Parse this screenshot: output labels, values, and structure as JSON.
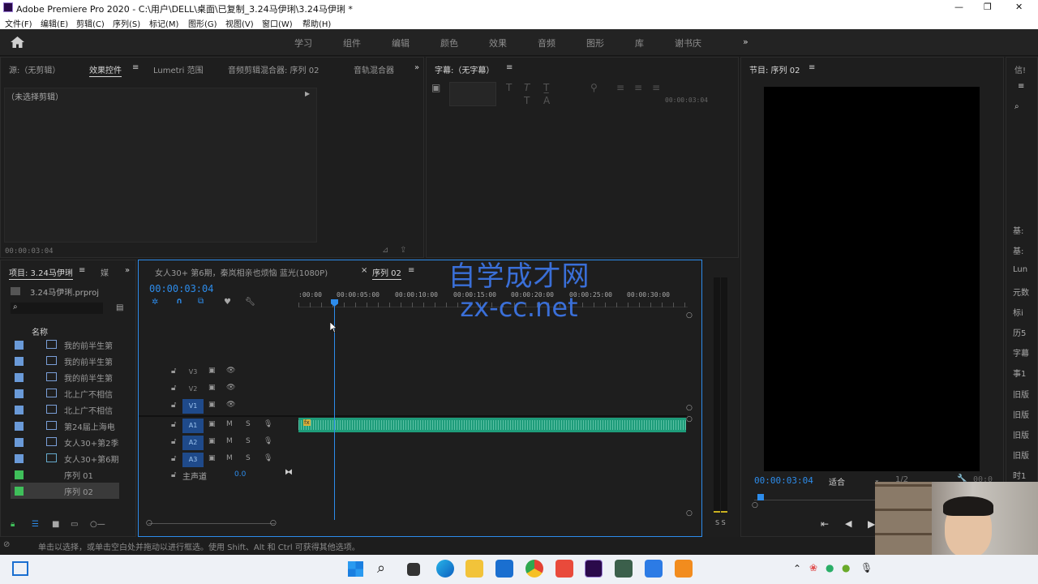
{
  "window": {
    "title": "Adobe Premiere Pro 2020 - C:\\用户\\DELL\\桌面\\已复制_3.24马伊琍\\3.24马伊琍 *",
    "controls": [
      "—",
      "❐",
      "✕"
    ]
  },
  "menu": [
    "文件(F)",
    "编辑(E)",
    "剪辑(C)",
    "序列(S)",
    "标记(M)",
    "图形(G)",
    "视图(V)",
    "窗口(W)",
    "帮助(H)"
  ],
  "workspaces": [
    "学习",
    "组件",
    "编辑",
    "颜色",
    "效果",
    "音频",
    "图形",
    "库",
    "谢书庆"
  ],
  "source_panel": {
    "tabs": [
      "源:（无剪辑）",
      "效果控件",
      "Lumetri 范围",
      "音频剪辑混合器: 序列 02",
      "音轨混合器"
    ],
    "no_clip": "（未选择剪辑）",
    "timecode": "00:00:03:04"
  },
  "captions_panel": {
    "tab": "字幕:（无字幕）",
    "timecode": "00:00:03:04"
  },
  "program_panel": {
    "tab": "节目: 序列 02",
    "timecode": "00:00:03:04",
    "fit": "适合",
    "ratio": "1/2",
    "end": "00:0"
  },
  "right_panel": {
    "tab": "信!",
    "items": [
      "基:",
      "基:",
      "Lun",
      "元数",
      "标i",
      "历5",
      "字幕",
      "事1",
      "旧版",
      "旧版",
      "旧版",
      "旧版",
      "时1"
    ]
  },
  "project_panel": {
    "tab": "项目: 3.24马伊琍",
    "tab2": "媒",
    "file": "3.24马伊琍.prproj",
    "column": "名称",
    "items": [
      {
        "name": "我的前半生第",
        "color": "#6a9ad8"
      },
      {
        "name": "我的前半生第",
        "color": "#6a9ad8"
      },
      {
        "name": "我的前半生第",
        "color": "#6a9ad8"
      },
      {
        "name": "北上广不相信",
        "color": "#6a9ad8"
      },
      {
        "name": "北上广不相信",
        "color": "#6a9ad8"
      },
      {
        "name": "第24届上海电",
        "color": "#6a9ad8"
      },
      {
        "name": "女人30+第2季",
        "color": "#6a9ad8"
      },
      {
        "name": "女人30+第6期",
        "color": "#6a9ad8"
      },
      {
        "name": "序列 01",
        "color": "#3fbf5a"
      },
      {
        "name": "序列 02",
        "color": "#3fbf5a"
      }
    ]
  },
  "timeline": {
    "tab1": "女人30+ 第6期，秦岚相亲也烦恼 蓝光(1080P)",
    "tab2": "序列 02",
    "timecode": "00:00:03:04",
    "ruler": [
      ":00:00",
      "00:00:05:00",
      "00:00:10:00",
      "00:00:15:00",
      "00:00:20:00",
      "00:00:25:00",
      "00:00:30:00"
    ],
    "video_tracks": [
      "V3",
      "V2",
      "V1"
    ],
    "audio_tracks": [
      "A1",
      "A2",
      "A3"
    ],
    "master": "主声道",
    "master_value": "0.0",
    "fx_badge": "fx",
    "m": "M",
    "s": "S"
  },
  "watermark": {
    "line1": "自学成才网",
    "line2": "zx-cc.net"
  },
  "meter_labels": "S S",
  "status": "单击以选择，或单击空白处并拖动以进行框选。使用 Shift、Alt 和 Ctrl 可获得其他选项。",
  "colors": {
    "accent": "#2d8ceb",
    "audio_clip": "#1e9c7a",
    "panel": "#1e1e1e"
  }
}
